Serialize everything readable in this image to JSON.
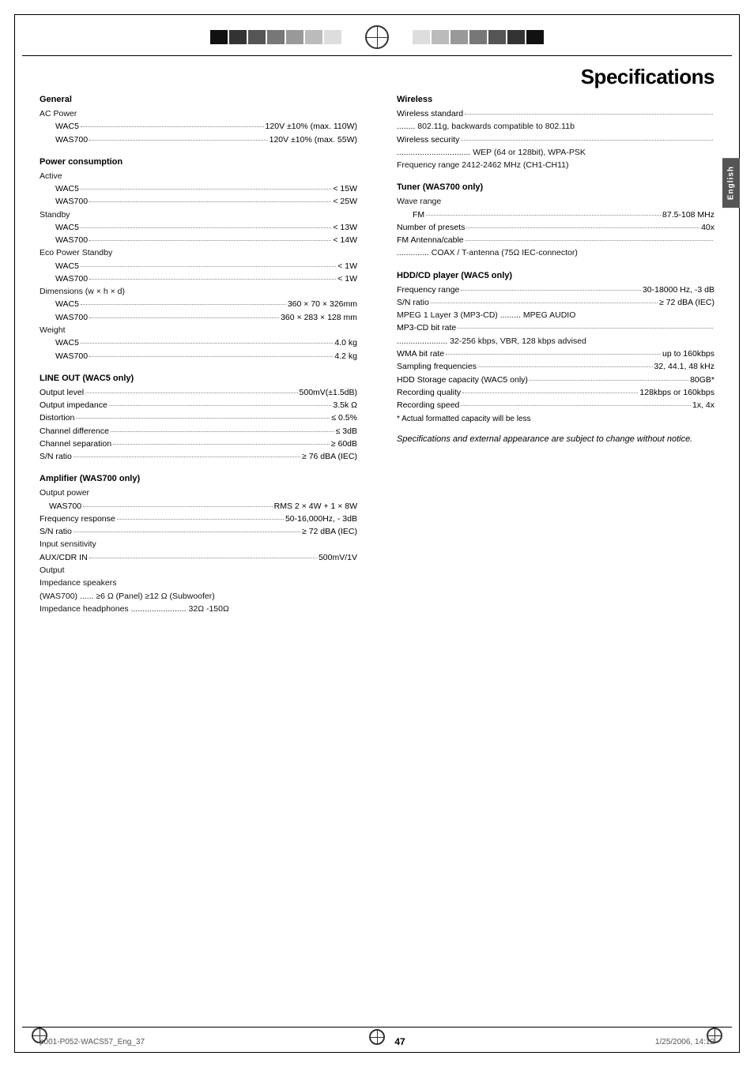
{
  "page": {
    "title": "Specifications",
    "page_number": "47",
    "footer_left": "p001-P052-WACS57_Eng_37",
    "footer_center": "47",
    "footer_right": "1/25/2006, 14:12"
  },
  "english_tab": "English",
  "sections": {
    "general": {
      "title": "General",
      "rows": [
        {
          "type": "plain",
          "text": "AC Power",
          "indent": 0
        },
        {
          "type": "dotted",
          "label": "WAC5",
          "dots": true,
          "value": "120V ±10% (max. 110W)",
          "indent": 2
        },
        {
          "type": "dotted",
          "label": "WAS700",
          "dots": true,
          "value": "120V ±10% (max. 55W)",
          "indent": 2
        }
      ]
    },
    "power_consumption": {
      "title": "Power consumption",
      "rows": [
        {
          "type": "plain",
          "text": "Active",
          "indent": 0
        },
        {
          "type": "dotted",
          "label": "WAC5",
          "dots": true,
          "value": "< 15W",
          "indent": 2
        },
        {
          "type": "dotted",
          "label": "WAS700",
          "dots": true,
          "value": "< 25W",
          "indent": 2
        },
        {
          "type": "plain",
          "text": "Standby",
          "indent": 0
        },
        {
          "type": "dotted",
          "label": "WAC5",
          "dots": true,
          "value": "< 13W",
          "indent": 2
        },
        {
          "type": "dotted",
          "label": "WAS700",
          "dots": true,
          "value": "< 14W",
          "indent": 2
        },
        {
          "type": "plain",
          "text": "Eco Power Standby",
          "indent": 0
        },
        {
          "type": "dotted",
          "label": "WAC5",
          "dots": true,
          "value": "< 1W",
          "indent": 2
        },
        {
          "type": "dotted",
          "label": "WAS700",
          "dots": true,
          "value": "< 1W",
          "indent": 2
        },
        {
          "type": "plain",
          "text": "Dimensions (w × h × d)",
          "indent": 0
        },
        {
          "type": "dotted",
          "label": "WAC5",
          "dots": true,
          "value": "360 × 70 × 326mm",
          "indent": 2
        },
        {
          "type": "dotted",
          "label": "WAS700",
          "dots": true,
          "value": "360 × 283 × 128 mm",
          "indent": 2
        },
        {
          "type": "plain",
          "text": "Weight",
          "indent": 0
        },
        {
          "type": "dotted",
          "label": "WAC5",
          "dots": true,
          "value": "4.0 kg",
          "indent": 2
        },
        {
          "type": "dotted",
          "label": "WAS700",
          "dots": true,
          "value": "4.2 kg",
          "indent": 2
        }
      ]
    },
    "line_out": {
      "title": "LINE OUT (WAC5 only)",
      "rows": [
        {
          "type": "dotted",
          "label": "Output level",
          "dots": true,
          "value": "500mV(±1.5dB)",
          "indent": 0
        },
        {
          "type": "dotted",
          "label": "Output impedance",
          "dots": true,
          "value": "3.5k Ω",
          "indent": 0
        },
        {
          "type": "dotted",
          "label": "Distortion",
          "dots": true,
          "value": "≤ 0.5%",
          "indent": 0
        },
        {
          "type": "dotted",
          "label": "Channel difference",
          "dots": true,
          "value": "≤ 3dB",
          "indent": 0
        },
        {
          "type": "dotted",
          "label": "Channel separation",
          "dots": true,
          "value": "≥ 60dB",
          "indent": 0
        },
        {
          "type": "dotted",
          "label": "S/N ratio",
          "dots": true,
          "value": "≥ 76 dBA (IEC)",
          "indent": 0
        }
      ]
    },
    "amplifier": {
      "title": "Amplifier (WAS700 only)",
      "rows": [
        {
          "type": "plain",
          "text": "Output power",
          "indent": 0
        },
        {
          "type": "dotted",
          "label": "WAS700",
          "dots": true,
          "value": "RMS 2 × 4W + 1 × 8W",
          "indent": 1
        },
        {
          "type": "dotted",
          "label": "Frequency response",
          "dots": true,
          "value": "50-16,000Hz, - 3dB",
          "indent": 0
        },
        {
          "type": "dotted",
          "label": "S/N ratio",
          "dots": true,
          "value": "≥ 72 dBA (IEC)",
          "indent": 0
        },
        {
          "type": "plain",
          "text": "Input sensitivity",
          "indent": 0
        },
        {
          "type": "dotted",
          "label": "AUX/CDR IN",
          "dots": true,
          "value": "500mV/1V",
          "indent": 0
        },
        {
          "type": "plain",
          "text": "Output",
          "indent": 0
        },
        {
          "type": "plain",
          "text": "Impedance speakers",
          "indent": 0
        },
        {
          "type": "plain",
          "text": "(WAS700) ...... ≥6 Ω (Panel) ≥12 Ω (Subwoofer)",
          "indent": 0
        },
        {
          "type": "plain",
          "text": "Impedance headphones ........................ 32Ω -150Ω",
          "indent": 0
        }
      ]
    },
    "wireless": {
      "title": "Wireless",
      "rows": [
        {
          "type": "dotted",
          "label": "Wireless standard",
          "dots": true,
          "value": "",
          "indent": 0
        },
        {
          "type": "plain",
          "text": "........ 802.11g, backwards compatible to 802.11b",
          "indent": 0
        },
        {
          "type": "dotted",
          "label": "Wireless security",
          "dots": true,
          "value": "",
          "indent": 0
        },
        {
          "type": "plain",
          "text": "................................ WEP (64 or 128bit), WPA-PSK",
          "indent": 0
        },
        {
          "type": "plain",
          "text": "Frequency range  2412-2462 MHz (CH1-CH11)",
          "indent": 0
        }
      ]
    },
    "tuner": {
      "title": "Tuner (WAS700 only)",
      "rows": [
        {
          "type": "plain",
          "text": "Wave range",
          "indent": 0
        },
        {
          "type": "dotted",
          "label": "FM",
          "dots": true,
          "value": "87.5-108 MHz",
          "indent": 2
        },
        {
          "type": "dotted",
          "label": "Number of presets",
          "dots": true,
          "value": "40x",
          "indent": 0
        },
        {
          "type": "dotted",
          "label": "FM Antenna/cable",
          "dots": true,
          "value": "",
          "indent": 0
        },
        {
          "type": "plain",
          "text": ".............. COAX / T-antenna (75Ω IEC-connector)",
          "indent": 0
        }
      ]
    },
    "hdd_cd": {
      "title": "HDD/CD player (WAC5 only)",
      "rows": [
        {
          "type": "dotted",
          "label": "Frequency range",
          "dots": true,
          "value": "30-18000 Hz, -3 dB",
          "indent": 0
        },
        {
          "type": "dotted",
          "label": "S/N ratio",
          "dots": true,
          "value": "≥  72 dBA (IEC)",
          "indent": 0
        },
        {
          "type": "plain",
          "text": "MPEG 1 Layer 3 (MP3-CD) ......... MPEG AUDIO",
          "indent": 0
        },
        {
          "type": "dotted",
          "label": "MP3-CD bit rate",
          "dots": true,
          "value": "",
          "indent": 0
        },
        {
          "type": "plain",
          "text": "...................... 32-256 kbps, VBR, 128 kbps advised",
          "indent": 0
        },
        {
          "type": "dotted",
          "label": "WMA bit rate",
          "dots": true,
          "value": "up to 160kbps",
          "indent": 0
        },
        {
          "type": "dotted",
          "label": "Sampling frequencies",
          "dots": true,
          "value": "32, 44.1, 48 kHz",
          "indent": 0
        },
        {
          "type": "dotted",
          "label": "HDD Storage capacity (WAC5 only)",
          "dots": true,
          "value": "80GB*",
          "indent": 0
        },
        {
          "type": "dotted",
          "label": "Recording quality",
          "dots": true,
          "value": "128kbps or 160kbps",
          "indent": 0
        },
        {
          "type": "dotted",
          "label": "Recording speed",
          "dots": true,
          "value": "1x, 4x",
          "indent": 0
        }
      ]
    }
  },
  "note": "* Actual formatted capacity will be less",
  "italic_note": "Specifications and external appearance are subject to change without notice."
}
